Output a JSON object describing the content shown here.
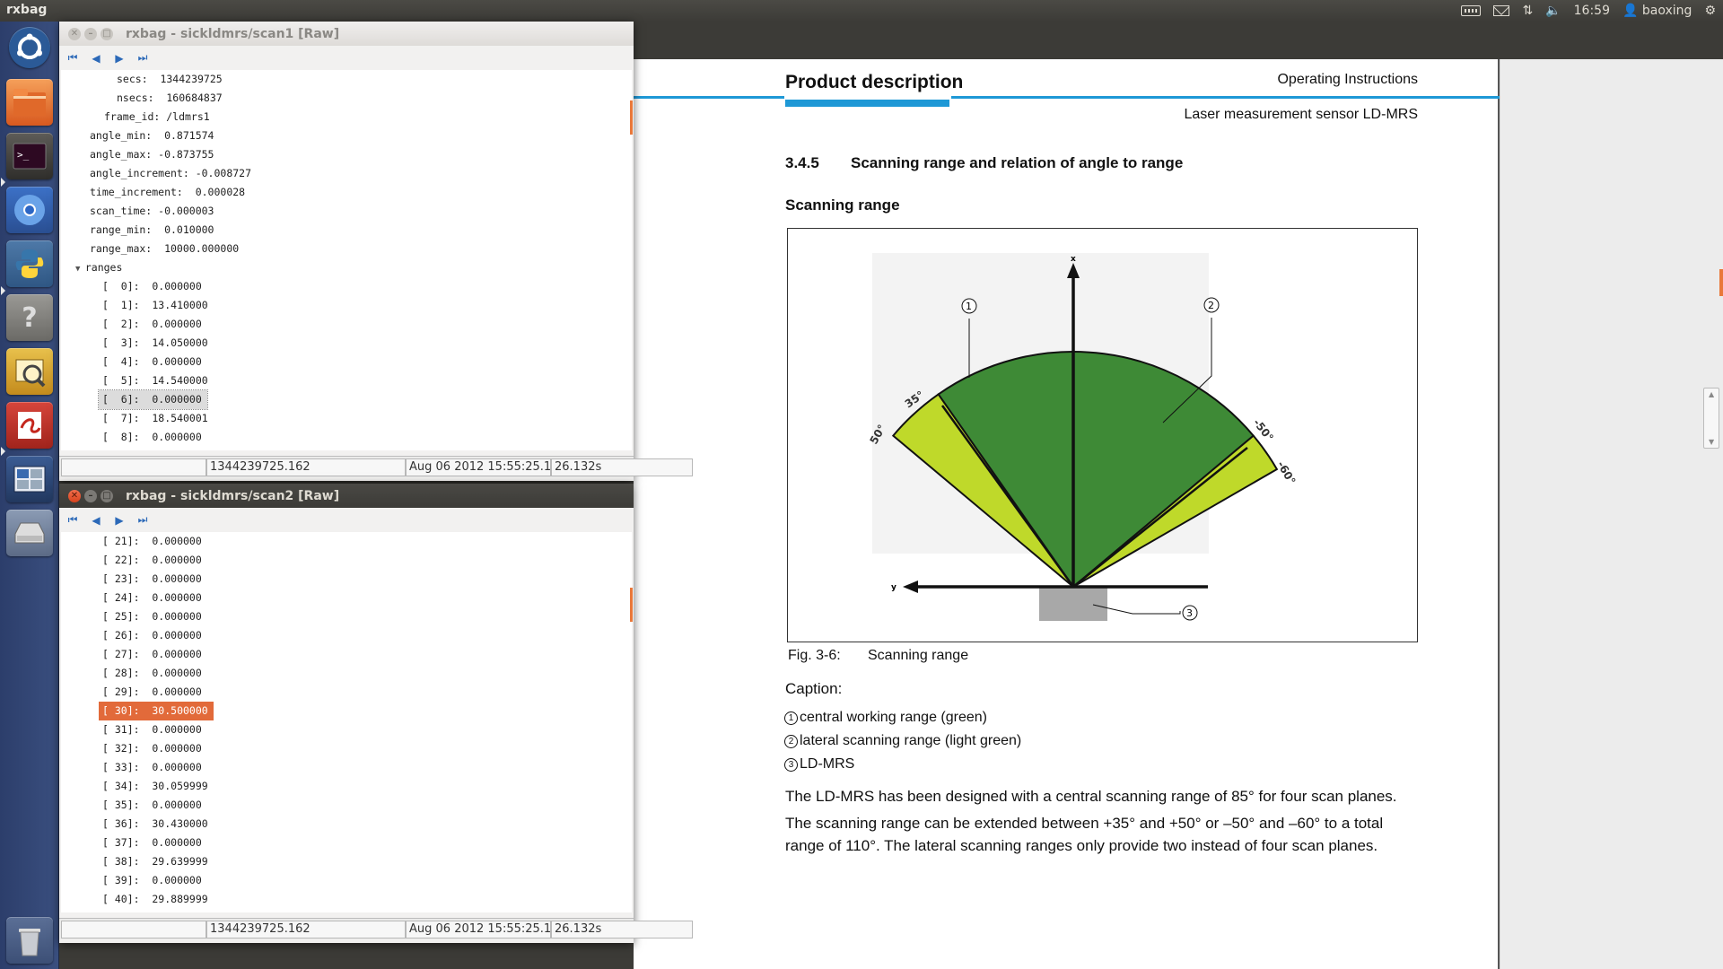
{
  "panel": {
    "app_title": "rxbag",
    "time": "16:59",
    "user": "baoxing"
  },
  "launcher": {
    "items": [
      {
        "name": "dash",
        "icon": "ubuntu-logo-icon"
      },
      {
        "name": "files",
        "icon": "folder-icon"
      },
      {
        "name": "terminal",
        "icon": "terminal-icon"
      },
      {
        "name": "chromium",
        "icon": "chromium-icon"
      },
      {
        "name": "python",
        "icon": "python-icon"
      },
      {
        "name": "help",
        "icon": "help-icon"
      },
      {
        "name": "image-viewer",
        "icon": "image-viewer-icon"
      },
      {
        "name": "document-viewer",
        "icon": "document-viewer-icon"
      },
      {
        "name": "workspace-switcher",
        "icon": "workspace-icon"
      },
      {
        "name": "drive",
        "icon": "drive-icon"
      },
      {
        "name": "trash",
        "icon": "trash-icon"
      }
    ]
  },
  "window1": {
    "title": "rxbag - sickldmrs/scan1 [Raw]",
    "rows": [
      {
        "text": "secs:  1344239725",
        "indent": 62
      },
      {
        "text": "nsecs:  160684837",
        "indent": 62
      },
      {
        "text": "frame_id: /ldmrs1",
        "indent": 48
      },
      {
        "text": "angle_min:  0.871574",
        "indent": 32
      },
      {
        "text": "angle_max: -0.873755",
        "indent": 32
      },
      {
        "text": "angle_increment: -0.008727",
        "indent": 32
      },
      {
        "text": "time_increment:  0.000028",
        "indent": 32
      },
      {
        "text": "scan_time: -0.000003",
        "indent": 32
      },
      {
        "text": "range_min:  0.010000",
        "indent": 32
      },
      {
        "text": "range_max:  10000.000000",
        "indent": 32
      },
      {
        "text": "ranges",
        "indent": 32,
        "expander": true
      },
      {
        "text": "[  0]:  0.000000",
        "indent": 46
      },
      {
        "text": "[  1]:  13.410000",
        "indent": 46
      },
      {
        "text": "[  2]:  0.000000",
        "indent": 46
      },
      {
        "text": "[  3]:  14.050000",
        "indent": 46
      },
      {
        "text": "[  4]:  0.000000",
        "indent": 46
      },
      {
        "text": "[  5]:  14.540000",
        "indent": 46
      },
      {
        "text": "[  6]:  0.000000",
        "indent": 46,
        "selected": true
      },
      {
        "text": "[  7]:  18.540001",
        "indent": 46
      },
      {
        "text": "[  8]:  0.000000",
        "indent": 46
      }
    ],
    "status": {
      "stamp": "1344239725.162",
      "date": "Aug 06 2012 15:55:25.1’",
      "elapsed": "26.132s"
    }
  },
  "window2": {
    "title": "rxbag - sickldmrs/scan2 [Raw]",
    "rows": [
      {
        "text": "[ 21]:  0.000000"
      },
      {
        "text": "[ 22]:  0.000000"
      },
      {
        "text": "[ 23]:  0.000000"
      },
      {
        "text": "[ 24]:  0.000000"
      },
      {
        "text": "[ 25]:  0.000000"
      },
      {
        "text": "[ 26]:  0.000000"
      },
      {
        "text": "[ 27]:  0.000000"
      },
      {
        "text": "[ 28]:  0.000000"
      },
      {
        "text": "[ 29]:  0.000000"
      },
      {
        "text": "[ 30]:  30.500000",
        "selected": true
      },
      {
        "text": "[ 31]:  0.000000"
      },
      {
        "text": "[ 32]:  0.000000"
      },
      {
        "text": "[ 33]:  0.000000"
      },
      {
        "text": "[ 34]:  30.059999"
      },
      {
        "text": "[ 35]:  0.000000"
      },
      {
        "text": "[ 36]:  30.430000"
      },
      {
        "text": "[ 37]:  0.000000"
      },
      {
        "text": "[ 38]:  29.639999"
      },
      {
        "text": "[ 39]:  0.000000"
      },
      {
        "text": "[ 40]:  29.889999"
      }
    ],
    "status": {
      "stamp": "1344239725.162",
      "date": "Aug 06 2012 15:55:25.1’",
      "elapsed": "26.132s"
    }
  },
  "document": {
    "section_title": "Product description",
    "doc_type": "Operating Instructions",
    "product": "Laser measurement sensor LD-MRS",
    "subsection_number": "3.4.5",
    "subsection_title": "Scanning range and relation of angle to range",
    "figure_heading": "Scanning range",
    "figure": {
      "label_1": "1",
      "label_2": "2",
      "label_3": "3",
      "axis_x": "x",
      "axis_y": "y",
      "angle_35": "35°",
      "angle_50": "50°",
      "angle_m50": "-50°",
      "angle_m60": "-60°",
      "colors": {
        "central": "#3e8a36",
        "lateral": "#bfd92a",
        "sensor": "#a8a8a8"
      }
    },
    "fig_number": "Fig. 3-6:",
    "fig_caption": "Scanning range",
    "caption_label": "Caption:",
    "caption_items": [
      {
        "num": "1",
        "text": "central working range (green)"
      },
      {
        "num": "2",
        "text": "lateral scanning range (light green)"
      },
      {
        "num": "3",
        "text": "LD-MRS"
      }
    ],
    "para1": "The LD-MRS has been designed with a central scanning range of 85° for four scan planes.",
    "para2": "The scanning range can be extended between +35° and +50° or –50° and –60° to a total range of 110°. The lateral scanning ranges only provide two instead of four scan planes."
  }
}
